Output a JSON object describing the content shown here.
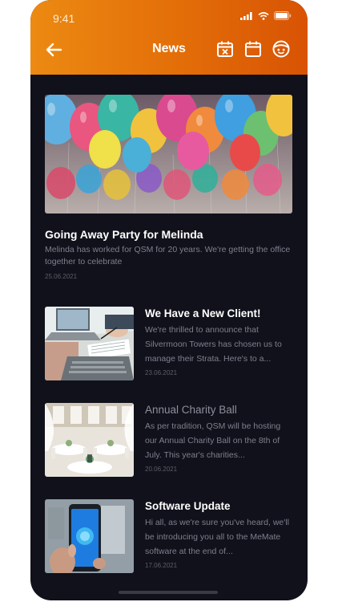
{
  "status": {
    "time": "9:41"
  },
  "header": {
    "title": "News"
  },
  "icons": {
    "back": "back-arrow-icon",
    "calendar_x": "calendar-x-icon",
    "calendar": "calendar-icon",
    "profile": "smiley-face-icon"
  },
  "colors": {
    "accent_start": "#ec8a12",
    "accent_end": "#d85304",
    "background": "#11111b"
  },
  "featured": {
    "title": "Going Away Party for Melinda",
    "summary": "Melinda has worked for QSM for 20 years. We're getting the office together to celebrate",
    "date": "25.06.2021"
  },
  "news": [
    {
      "title": "We Have a New Client!",
      "summary": "We're thrilled to announce that Silvermoon Towers has chosen us to manage their Strata. Here's to a...",
      "date": "23.06.2021"
    },
    {
      "title": "Annual Charity Ball",
      "summary": "As per tradition, QSM will be hosting our Annual Charity Ball on the 8th of July. This year's charities...",
      "date": "20.06.2021"
    },
    {
      "title": "Software Update",
      "summary": "Hi all, as we're sure you've heard, we'll be introducing you all to the MeMate software at the end of...",
      "date": "17.06.2021"
    }
  ]
}
